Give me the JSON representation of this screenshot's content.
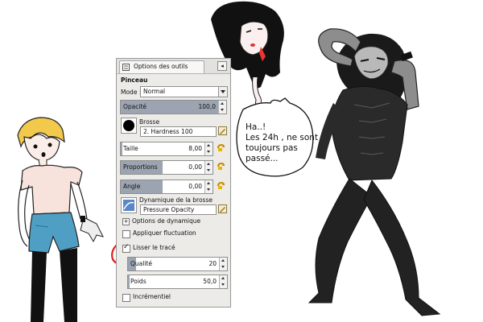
{
  "panel": {
    "tab_label": "Options des outils",
    "tab_menu_icon": "tab-menu-icon",
    "tool_name": "Pinceau",
    "mode_label": "Mode :",
    "mode_value": "Normal",
    "opacity": {
      "label": "Opacité",
      "value": "100,0",
      "fraction": 1.0
    },
    "brush": {
      "label": "Brosse",
      "value": "2. Hardness 100"
    },
    "size": {
      "label": "Taille",
      "value": "8,00",
      "fraction": 0.02
    },
    "proportions": {
      "label": "Proportions",
      "value": "0,00",
      "fraction": 0.5
    },
    "angle": {
      "label": "Angle",
      "value": "0,00",
      "fraction": 0.5
    },
    "dynamics": {
      "label": "Dynamique de la brosse",
      "value": "Pressure Opacity"
    },
    "dynamics_options": "Options de dynamique",
    "apply_jitter": {
      "label": "Appliquer fluctuation",
      "checked": false
    },
    "smooth_stroke": {
      "label": "Lisser le tracé",
      "checked": true
    },
    "quality": {
      "label": "Qualité",
      "value": "20",
      "fraction": 0.09
    },
    "weight": {
      "label": "Poids",
      "value": "50,0",
      "fraction": 0.02
    },
    "incremental": {
      "label": "Incrémentiel",
      "checked": false
    }
  },
  "speech": {
    "lines": [
      "Ha..!",
      "Les 24h , ne sont",
      "toujours pas",
      "passé..."
    ]
  },
  "colors": {
    "slider_fill": "#9ba4b0",
    "panel_bg": "#ecebe8",
    "annotation_red": "#e0201c"
  }
}
